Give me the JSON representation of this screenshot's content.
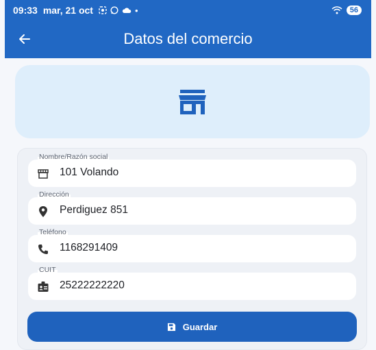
{
  "status_bar": {
    "time": "09:33",
    "date": "mar, 21 oct",
    "battery": "56",
    "notification_icons": [
      "screen-record-icon",
      "whatsapp-icon",
      "cloud-icon",
      "dot-icon"
    ],
    "right_icons": [
      "wifi-icon",
      "battery-icon"
    ]
  },
  "appbar": {
    "title": "Datos del comercio",
    "back_icon": "arrow-left-icon",
    "background_color": "#2168c4"
  },
  "hero": {
    "icon": "store-icon",
    "background_color": "#deeefb",
    "icon_color": "#1f62bd"
  },
  "form": {
    "fields": [
      {
        "label": "Nombre/Razón social",
        "value": "101 Volando",
        "icon": "storefront-icon"
      },
      {
        "label": "Dirección",
        "value": "Perdiguez 851",
        "icon": "location-pin-icon"
      },
      {
        "label": "Teléfono",
        "value": "1168291409",
        "icon": "phone-icon"
      },
      {
        "label": "CUIT",
        "value": "25222222220",
        "icon": "id-badge-icon"
      }
    ],
    "save_button": {
      "label": "Guardar",
      "icon": "save-icon"
    }
  },
  "colors": {
    "primary": "#1f62bd",
    "page_background": "#f5f7fb",
    "card_background": "#eef1f6"
  }
}
